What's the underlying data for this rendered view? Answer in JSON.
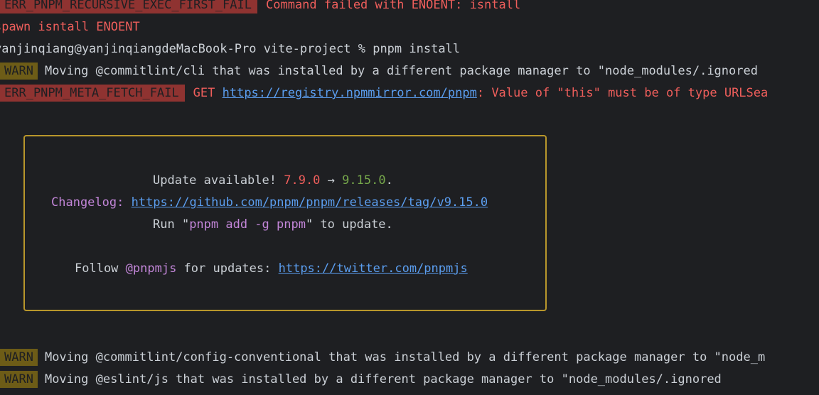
{
  "colors": {
    "background": "#1e1f22",
    "error_badge": "#8f3331",
    "warn_badge": "#6d5c17",
    "error_text": "#ee5e5b",
    "link": "#5b9ef0",
    "purple": "#c386d9",
    "green": "#76a84b",
    "box_border": "#b8962b"
  },
  "lines": {
    "l1_badge": "ERR_PNPM_RECURSIVE_EXEC_FIRST_FAIL",
    "l1_msg": "Command failed with ENOENT: isntall",
    "l2": "spawn isntall ENOENT",
    "l3_prompt": "yanjinqiang@yanjinqiangdeMacBook-Pro vite-project % pnpm install",
    "l4_badge": "WARN",
    "l4_msg": "Moving @commitlint/cli that was installed by a different package manager to \"node_modules/.ignored",
    "l5_badge": "ERR_PNPM_META_FETCH_FAIL",
    "l5_get": "GET",
    "l5_url": "https://registry.npmmirror.com/pnpm",
    "l5_msg": ": Value of \"this\" must be of type URLSea",
    "l6_badge": "WARN",
    "l6_msg": "Moving @commitlint/config-conventional that was installed by a different package manager to \"node_m",
    "l7_badge": "WARN",
    "l7_msg": "Moving @eslint/js that was installed by a different package manager to \"node_modules/.ignored"
  },
  "update_box": {
    "update_prefix": "Update available! ",
    "old_version": "7.9.0",
    "arrow": " → ",
    "new_version": "9.15.0",
    "period": ".",
    "changelog_label": "Changelog: ",
    "changelog_url": "https://github.com/pnpm/pnpm/releases/tag/v9.15.0",
    "run_prefix": "Run \"",
    "run_cmd": "pnpm add -g pnpm",
    "run_suffix": "\" to update.",
    "follow_prefix": "Follow ",
    "follow_handle": "@pnpmjs",
    "follow_mid": " for updates: ",
    "twitter_url": "https://twitter.com/pnpmjs"
  }
}
